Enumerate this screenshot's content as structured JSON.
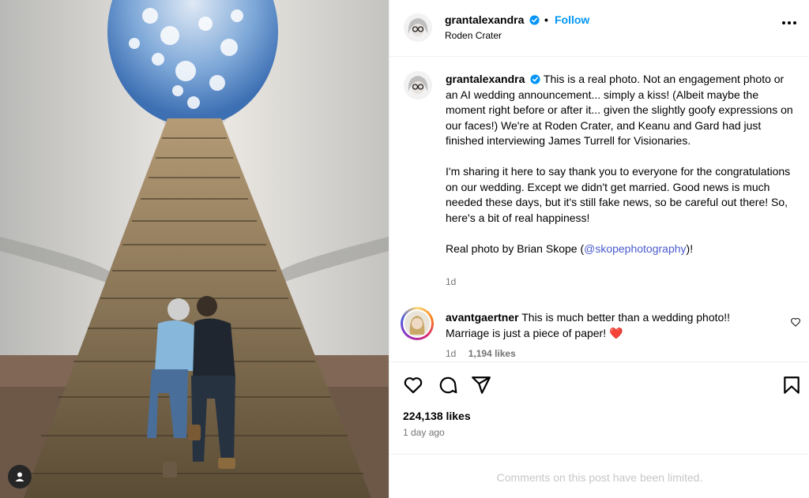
{
  "post": {
    "username": "grantalexandra",
    "verified": true,
    "separator": "•",
    "follow_label": "Follow",
    "location": "Roden Crater",
    "more_icon": "more-horizontal-icon"
  },
  "caption": {
    "username": "grantalexandra",
    "paragraph1": "This is a real photo. Not an engagement photo or an AI wedding announcement... simply a kiss! (Albeit maybe the moment right before or after it... given the slightly goofy expressions on our faces!) We're at Roden Crater, and Keanu and Gard had just finished interviewing James Turrell for Visionaries.",
    "paragraph2": "I'm sharing it here to say thank you to everyone for the congratulations on our wedding. Except we didn't get married. Good news is much needed these days, but it's still fake news, so be careful out there! So, here's a bit of real happiness!",
    "paragraph3_prefix": "Real photo by Brian Skope (",
    "mention": "@skopephotography",
    "paragraph3_suffix": ")!",
    "time": "1d"
  },
  "comment": {
    "username": "avantgaertner",
    "text": "This is much better than a wedding photo!! Marriage is just a piece of paper!",
    "emoji": "❤️",
    "time": "1d",
    "likes": "1,194 likes"
  },
  "actions": {
    "like_icon": "heart-icon",
    "comment_icon": "comment-icon",
    "share_icon": "share-icon",
    "save_icon": "bookmark-icon"
  },
  "likes_count": "224,138 likes",
  "posted_ago": "1 day ago",
  "comments_limited": "Comments on this post have been limited.",
  "colors": {
    "link": "#0095f6",
    "muted": "#737373",
    "heart": "#ed4956"
  }
}
